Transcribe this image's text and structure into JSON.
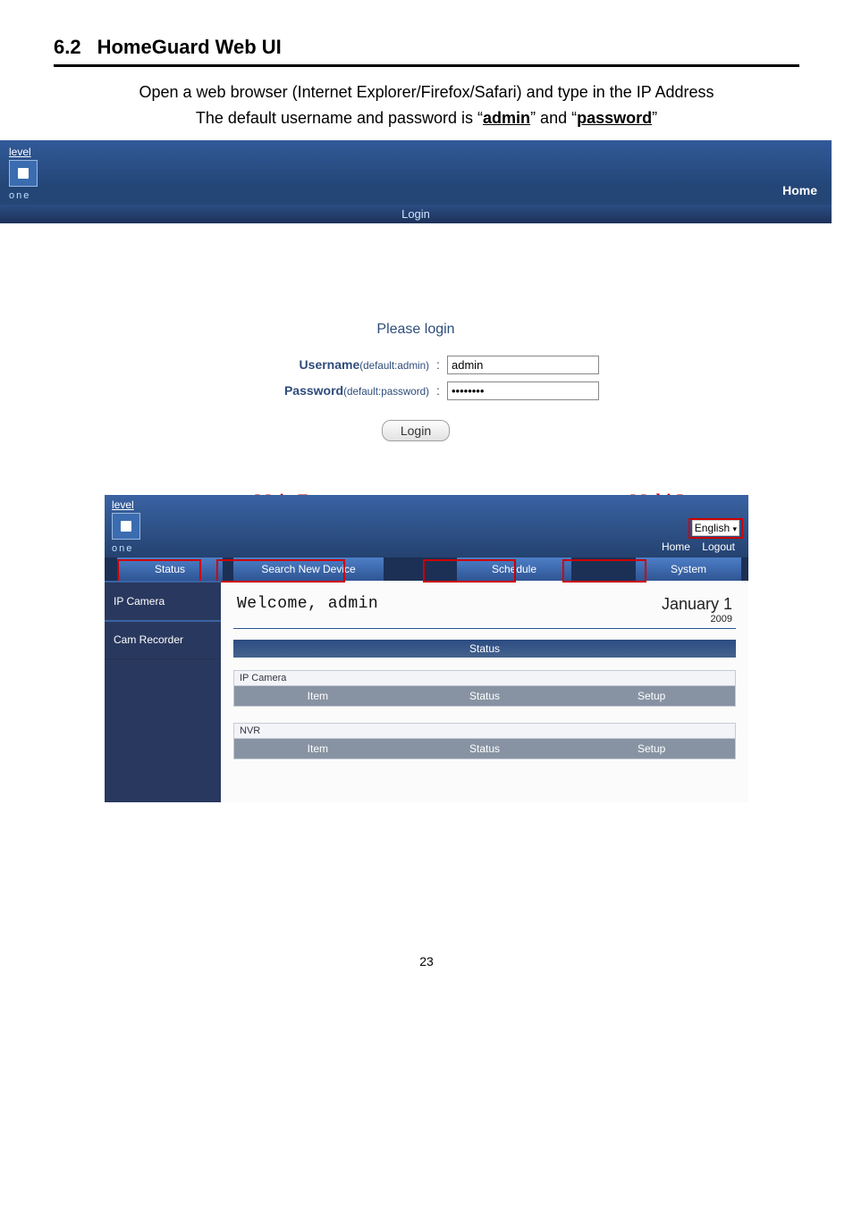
{
  "heading": {
    "number": "6.2",
    "title": "HomeGuard Web UI"
  },
  "intro": {
    "line1_a": "Open a web browser (Internet Explorer/Firefox/Safari) and type in the IP Address",
    "line2_a": "The default username and password is “",
    "admin": "admin",
    "line2_b": "” and “",
    "password": "password",
    "line2_c": "”"
  },
  "login_shot": {
    "brand_top": "level",
    "brand_bottom": "one",
    "home": "Home",
    "tab": "Login",
    "please": "Please login",
    "user_label_strong": "Username",
    "user_label_small": "(default:admin)",
    "user_value": "admin",
    "pass_label_strong": "Password",
    "pass_label_small": "(default:password)",
    "pass_value": "••••••••",
    "login_btn": "Login"
  },
  "annot": {
    "main_feature": "Main Feature",
    "multi_language": "Multi-Language"
  },
  "dash": {
    "brand_top": "level",
    "brand_bottom": "one",
    "lang_value": "English",
    "header_links": {
      "home": "Home",
      "logout": "Logout"
    },
    "tabs": {
      "status": "Status",
      "search": "Search New Device",
      "schedule": "Schedule",
      "system": "System"
    },
    "sidebar": [
      "IP Camera",
      "Cam Recorder"
    ],
    "welcome": "Welcome, admin",
    "date_main": "January 1",
    "date_year": "2009",
    "status_label": "Status",
    "groups": [
      {
        "caption": "IP Camera",
        "cols": [
          "Item",
          "Status",
          "Setup"
        ]
      },
      {
        "caption": "NVR",
        "cols": [
          "Item",
          "Status",
          "Setup"
        ]
      }
    ]
  },
  "page_number": "23"
}
